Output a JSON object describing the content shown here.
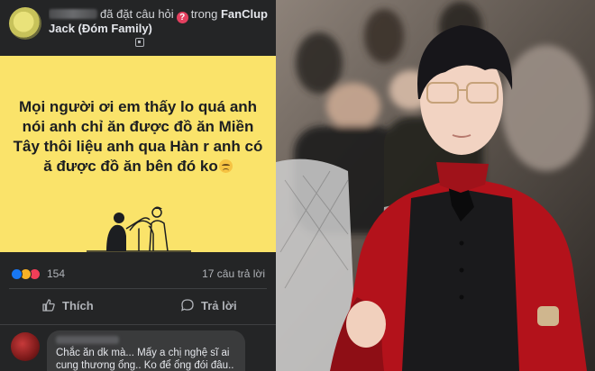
{
  "post": {
    "action_text": "đã đặt câu hỏi",
    "question_icon": "?",
    "in_text": "trong",
    "group_name_part1": "FanClup",
    "group_name_part2": "Jack (Đóm Family)",
    "privacy_icon": "group-privacy-icon",
    "question_text": "Mọi người ơi em thấy lo quá anh nói anh chỉ ăn được đồ ăn Miền Tây thôi liệu anh qua Hàn r anh có ă được đồ ăn bên đó ko",
    "card_color": "#fae36a",
    "reaction_count": "154",
    "answer_count": "17 câu trả lời",
    "like_label": "Thích",
    "reply_label": "Trả lời",
    "comment_text": "Chắc ăn dk mà... Mấy a chị nghệ sĩ ai cung thương ổng.. Ko để ổng đói đâu.. Chăm ổng như a bé"
  },
  "colors": {
    "background": "#242526",
    "text": "#e4e6eb",
    "muted": "#b0b3b8",
    "like_blue": "#1877f2",
    "love_red": "#f33e58",
    "sad_yellow": "#f7b125"
  }
}
